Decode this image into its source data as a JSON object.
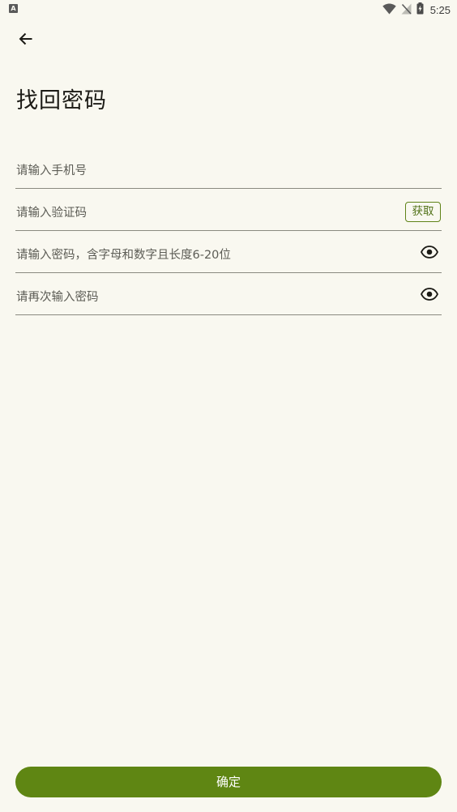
{
  "status_bar": {
    "left_icon_text": "A",
    "time": "5:25"
  },
  "header": {
    "title": "找回密码"
  },
  "form": {
    "phone_placeholder": "请输入手机号",
    "code_placeholder": "请输入验证码",
    "get_code_label": "获取",
    "password_placeholder": "请输入密码，含字母和数字且长度6-20位",
    "confirm_password_placeholder": "请再次输入密码"
  },
  "actions": {
    "confirm_label": "确定"
  },
  "colors": {
    "background": "#f9f8f0",
    "accent": "#5f8613"
  }
}
